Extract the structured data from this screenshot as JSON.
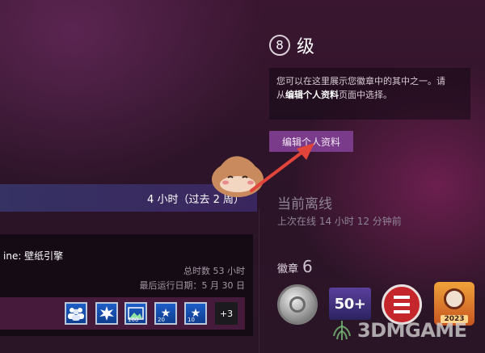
{
  "profile": {
    "level_number": "8",
    "level_label": "级",
    "info_line1": "您可以在这里展示您徽章中的其中之一。请",
    "info_prefix": "从",
    "info_bold": "编辑个人资料",
    "info_suffix": "页面中选择。",
    "edit_button": "编辑个人资料"
  },
  "status": {
    "title": "当前离线",
    "last_online": "上次在线 14 小时 12 分钟前"
  },
  "badges": {
    "label": "徽章",
    "count": "6",
    "items": [
      {
        "icon": "silver-coin-badge-icon"
      },
      {
        "icon": "level-50-badge-icon",
        "text": "50+"
      },
      {
        "icon": "red-emblem-badge-icon"
      },
      {
        "icon": "steam-2023-badge-icon",
        "text": "2023"
      }
    ]
  },
  "game": {
    "hours_summary": "4 小时（过去 2 周）",
    "name": "ine: 壁纸引擎",
    "total_time": "总时数 53 小时",
    "last_played": "最后运行日期：5 月 30 日",
    "achievements": [
      {
        "icon": "people-achievement-icon",
        "num": ""
      },
      {
        "icon": "splash-achievement-icon",
        "num": ""
      },
      {
        "icon": "image-achievement-icon",
        "num": "100"
      },
      {
        "icon": "star-achievement-icon",
        "num": "20"
      },
      {
        "icon": "star-achievement-icon",
        "num": "10"
      }
    ],
    "more_achievements": "+3"
  },
  "watermark": {
    "text": "3DMGAME"
  },
  "colors": {
    "edit_button": "#7a3c8a",
    "hours_bar": "#3c3a6e",
    "arrow": "#e0443a",
    "mascot": "#c98a5e"
  }
}
